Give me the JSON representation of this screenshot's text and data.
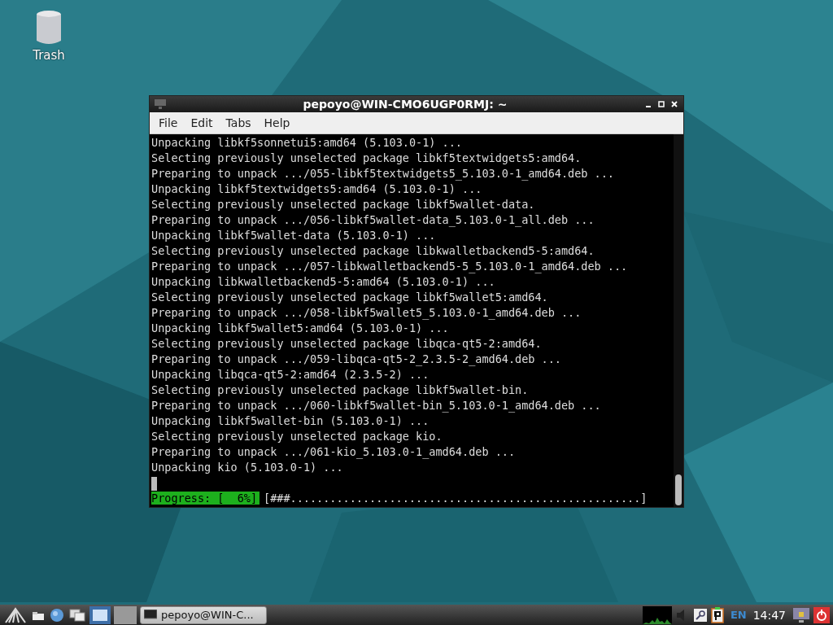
{
  "desktop": {
    "icons": [
      {
        "label": "Trash"
      }
    ]
  },
  "window": {
    "title": "pepoyo@WIN-CMO6UGP0RMJ: ~",
    "menu": [
      "File",
      "Edit",
      "Tabs",
      "Help"
    ],
    "lines": [
      "Unpacking libkf5sonnetui5:amd64 (5.103.0-1) ...",
      "Selecting previously unselected package libkf5textwidgets5:amd64.",
      "Preparing to unpack .../055-libkf5textwidgets5_5.103.0-1_amd64.deb ...",
      "Unpacking libkf5textwidgets5:amd64 (5.103.0-1) ...",
      "Selecting previously unselected package libkf5wallet-data.",
      "Preparing to unpack .../056-libkf5wallet-data_5.103.0-1_all.deb ...",
      "Unpacking libkf5wallet-data (5.103.0-1) ...",
      "Selecting previously unselected package libkwalletbackend5-5:amd64.",
      "Preparing to unpack .../057-libkwalletbackend5-5_5.103.0-1_amd64.deb ...",
      "Unpacking libkwalletbackend5-5:amd64 (5.103.0-1) ...",
      "Selecting previously unselected package libkf5wallet5:amd64.",
      "Preparing to unpack .../058-libkf5wallet5_5.103.0-1_amd64.deb ...",
      "Unpacking libkf5wallet5:amd64 (5.103.0-1) ...",
      "Selecting previously unselected package libqca-qt5-2:amd64.",
      "Preparing to unpack .../059-libqca-qt5-2_2.3.5-2_amd64.deb ...",
      "Unpacking libqca-qt5-2:amd64 (2.3.5-2) ...",
      "Selecting previously unselected package libkf5wallet-bin.",
      "Preparing to unpack .../060-libkf5wallet-bin_5.103.0-1_amd64.deb ...",
      "Unpacking libkf5wallet-bin (5.103.0-1) ...",
      "Selecting previously unselected package kio.",
      "Preparing to unpack .../061-kio_5.103.0-1_amd64.deb ...",
      "Unpacking kio (5.103.0-1) ..."
    ],
    "progress_label": "Progress: [  6%]",
    "progress_bar": "[###.....................................................]"
  },
  "taskbar": {
    "task": {
      "label": "pepoyo@WIN-C...",
      "selected": false
    },
    "language": "EN",
    "clock": "14:47"
  }
}
